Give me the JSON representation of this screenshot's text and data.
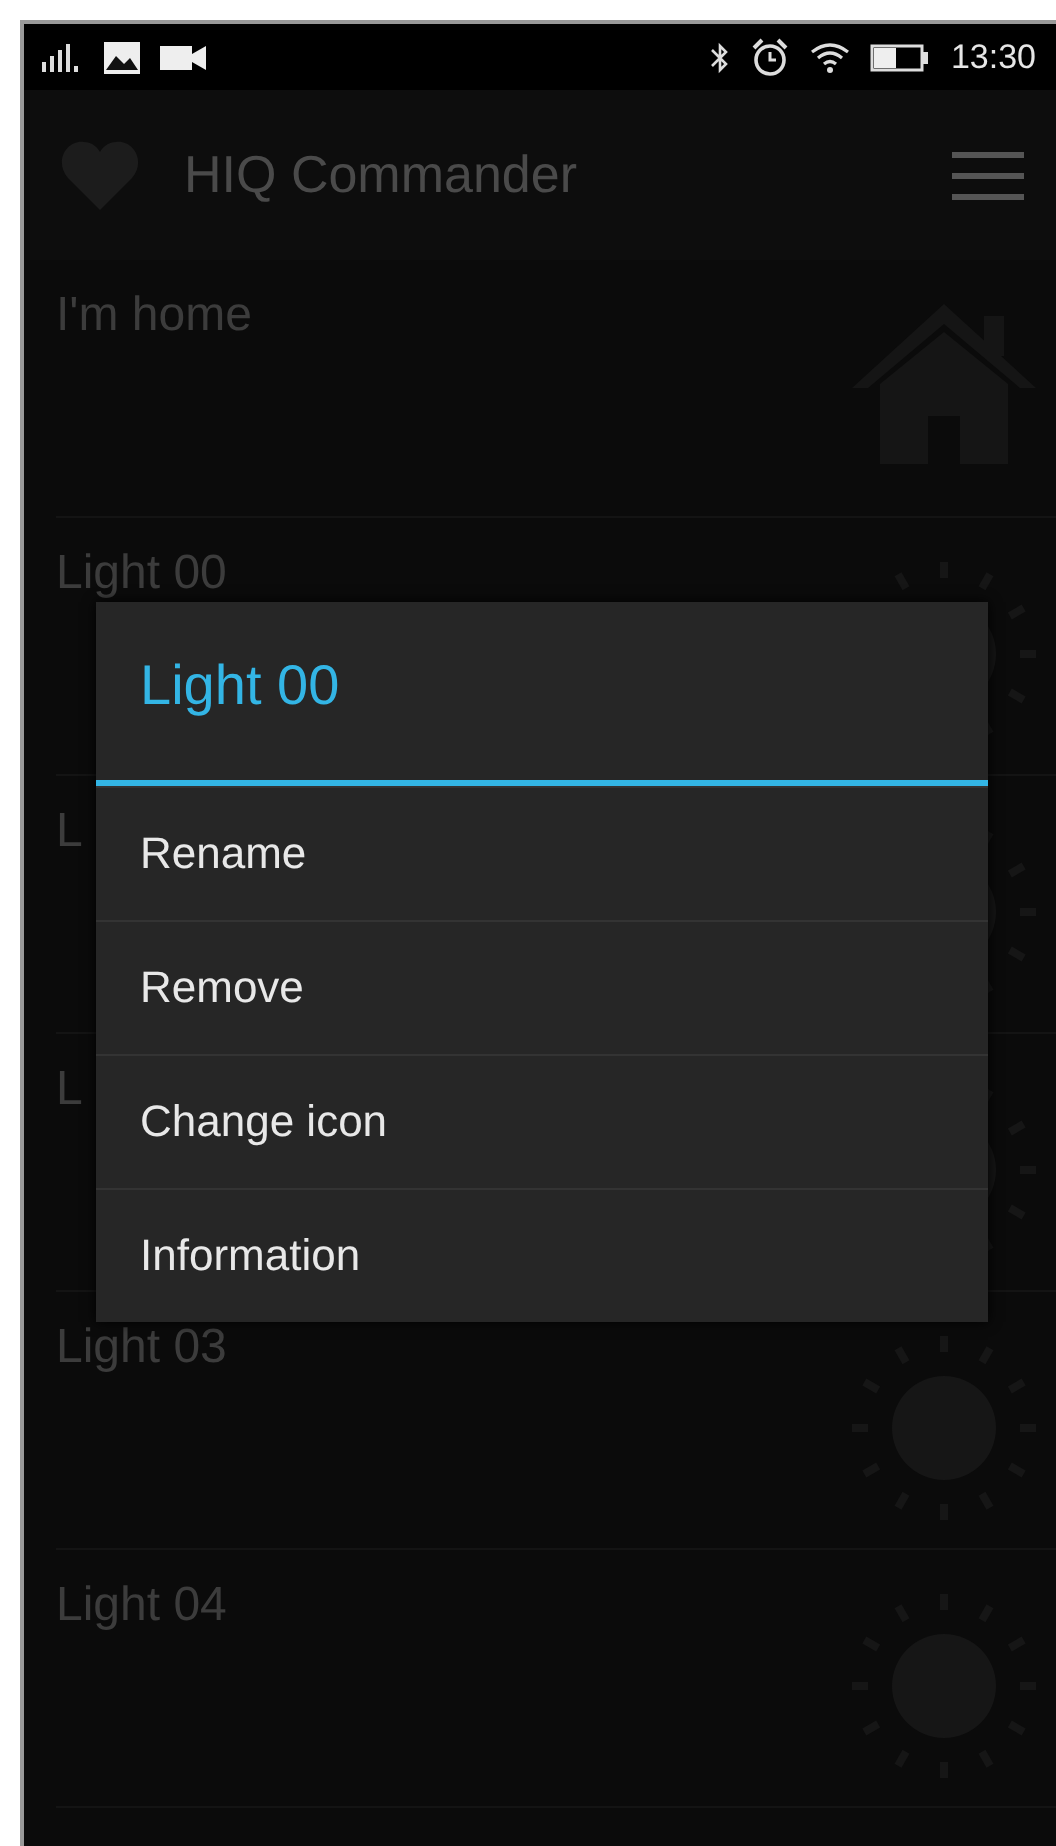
{
  "status_bar": {
    "time": "13:30"
  },
  "app_bar": {
    "title": "HIQ Commander"
  },
  "rows": [
    {
      "label": "I'm home",
      "kind": "home"
    },
    {
      "label": "Light 00",
      "kind": "light"
    },
    {
      "label": "L",
      "kind": "light"
    },
    {
      "label": "L",
      "kind": "light"
    },
    {
      "label": "Light 03",
      "kind": "light"
    },
    {
      "label": "Light 04",
      "kind": "light"
    }
  ],
  "dialog": {
    "title": "Light 00",
    "items": [
      "Rename",
      "Remove",
      "Change icon",
      "Information"
    ]
  }
}
